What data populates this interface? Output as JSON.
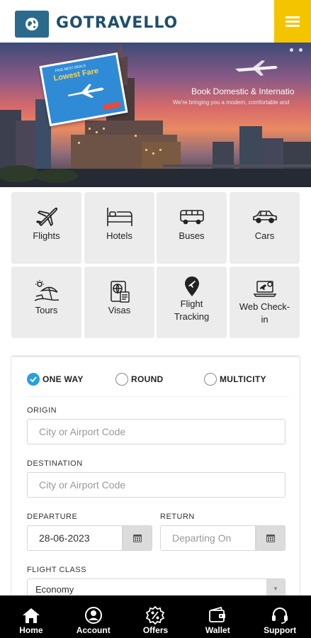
{
  "header": {
    "logo_icon": "globe-icon",
    "brand": "GOTRAVELLO",
    "menu_icon": "hamburger-icon",
    "accent_color": "#f5c400",
    "brand_color": "#1f4f70"
  },
  "hero": {
    "headline": "Book Domestic & Internatio",
    "subline": "We're bringing you a modern, comfortable and",
    "promo_small": "FIND BEST DEALS",
    "promo_big": "Lowest Fare",
    "slides": 2
  },
  "services": [
    {
      "label": "Flights",
      "icon": "airplane-icon"
    },
    {
      "label": "Hotels",
      "icon": "bed-icon"
    },
    {
      "label": "Buses",
      "icon": "bus-icon"
    },
    {
      "label": "Cars",
      "icon": "car-icon"
    },
    {
      "label": "Tours",
      "icon": "beach-umbrella-icon"
    },
    {
      "label": "Visas",
      "icon": "passport-icon"
    },
    {
      "label": "Flight Tracking",
      "icon": "location-pin-plane-icon"
    },
    {
      "label": "Web Check-in",
      "icon": "laptop-checkin-icon"
    }
  ],
  "form": {
    "trip_types": [
      {
        "label": "ONE WAY",
        "selected": true
      },
      {
        "label": "ROUND",
        "selected": false
      },
      {
        "label": "MULTICITY",
        "selected": false
      }
    ],
    "origin": {
      "label": "ORIGIN",
      "placeholder": "City or Airport Code",
      "value": ""
    },
    "destination": {
      "label": "DESTINATION",
      "placeholder": "City or Airport Code",
      "value": ""
    },
    "departure": {
      "label": "DEPARTURE",
      "value": "28-06-2023"
    },
    "return": {
      "label": "RETURN",
      "placeholder": "Departing On",
      "value": ""
    },
    "flight_class": {
      "label": "FLIGHT CLASS",
      "value": "Economy"
    },
    "selected_color": "#2aa0e0"
  },
  "bottom_nav": [
    {
      "label": "Home",
      "icon": "home-icon"
    },
    {
      "label": "Account",
      "icon": "user-icon"
    },
    {
      "label": "Offers",
      "icon": "percent-badge-icon"
    },
    {
      "label": "Wallet",
      "icon": "wallet-icon"
    },
    {
      "label": "Support",
      "icon": "headset-icon"
    }
  ]
}
